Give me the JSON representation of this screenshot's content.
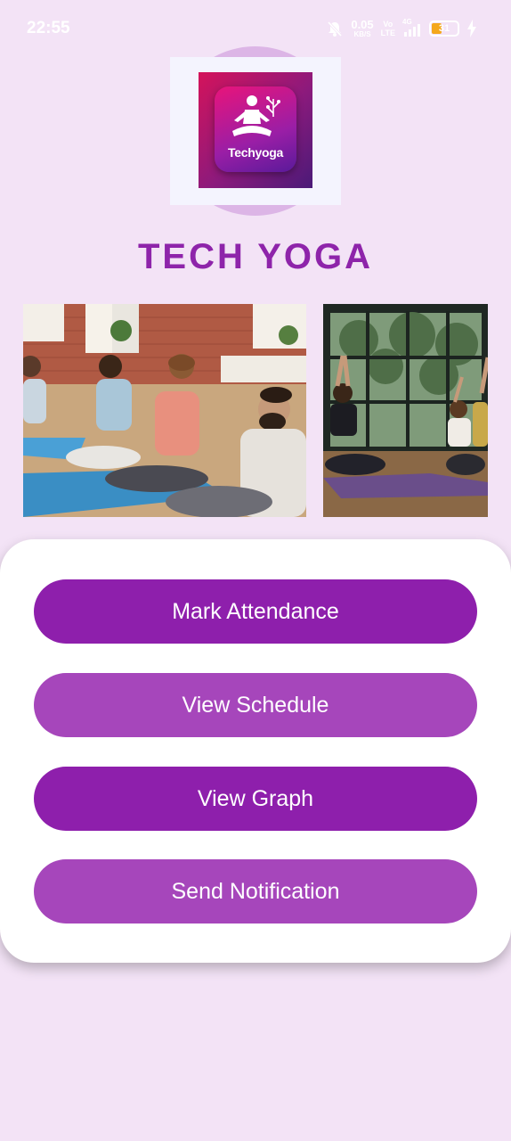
{
  "status_bar": {
    "time": "22:55",
    "net_speed_value": "0.05",
    "net_speed_unit": "KB/S",
    "volte_top": "Vo",
    "volte_bottom": "LTE",
    "signal_label": "4G",
    "battery_level": "31",
    "icons": [
      "mute-bell-icon",
      "signal-icon",
      "battery-icon",
      "charging-bolt-icon"
    ]
  },
  "logo": {
    "text": "Techyoga"
  },
  "app_title": "TECH YOGA",
  "buttons": {
    "mark_attendance": "Mark Attendance",
    "view_schedule": "View Schedule",
    "view_graph": "View Graph",
    "send_notification": "Send Notification"
  },
  "colors": {
    "background": "#f3e3f6",
    "title": "#8e24aa",
    "button_dark": "#8e1fac",
    "button_light": "#a646bb",
    "card": "#ffffff"
  }
}
